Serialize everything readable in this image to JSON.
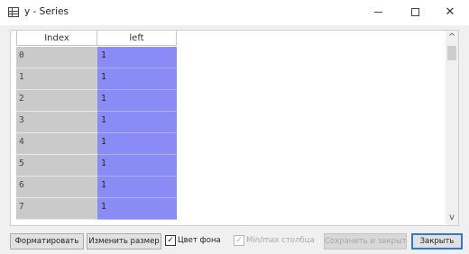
{
  "window": {
    "title": "y - Series",
    "min_glyph": "",
    "close_glyph": "✕"
  },
  "grid": {
    "columns": [
      "Index",
      "left"
    ],
    "rows": [
      {
        "index": "0",
        "left": "1"
      },
      {
        "index": "1",
        "left": "1"
      },
      {
        "index": "2",
        "left": "1"
      },
      {
        "index": "3",
        "left": "1"
      },
      {
        "index": "4",
        "left": "1"
      },
      {
        "index": "5",
        "left": "1"
      },
      {
        "index": "6",
        "left": "1"
      },
      {
        "index": "7",
        "left": "1"
      }
    ],
    "scroll_up": "^",
    "scroll_down": "v"
  },
  "toolbar": {
    "format_label": "Форматировать",
    "resize_label": "Изменить размер",
    "bg_color_label": "Цвет фона",
    "bg_color_checked": true,
    "minmax_label": "Min/max столбца",
    "minmax_checked": true,
    "minmax_enabled": false,
    "save_close_label": "Сохранить и закрыть",
    "close_label": "Закрыть",
    "check_glyph": "✓"
  },
  "colors": {
    "index_column": "#cacaca",
    "value_cell": "#8b8bf6",
    "close_button_border": "#2b7bd4"
  }
}
